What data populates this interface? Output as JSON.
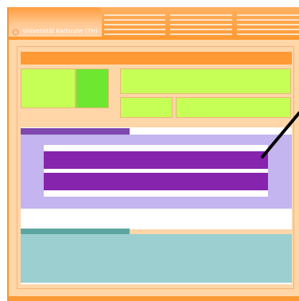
{
  "header": {
    "site_title": "Universität Karlsruhe (TH)",
    "home_icon": "home-icon"
  },
  "colors": {
    "frame_orange": "#ff9933",
    "page_peach": "#ffd6a8",
    "green_light": "#c6ff55",
    "green_strong": "#6ee730",
    "purple_panel": "#c4b4ef",
    "purple_row": "#8624ad",
    "teal_panel": "#9ccfcf"
  }
}
